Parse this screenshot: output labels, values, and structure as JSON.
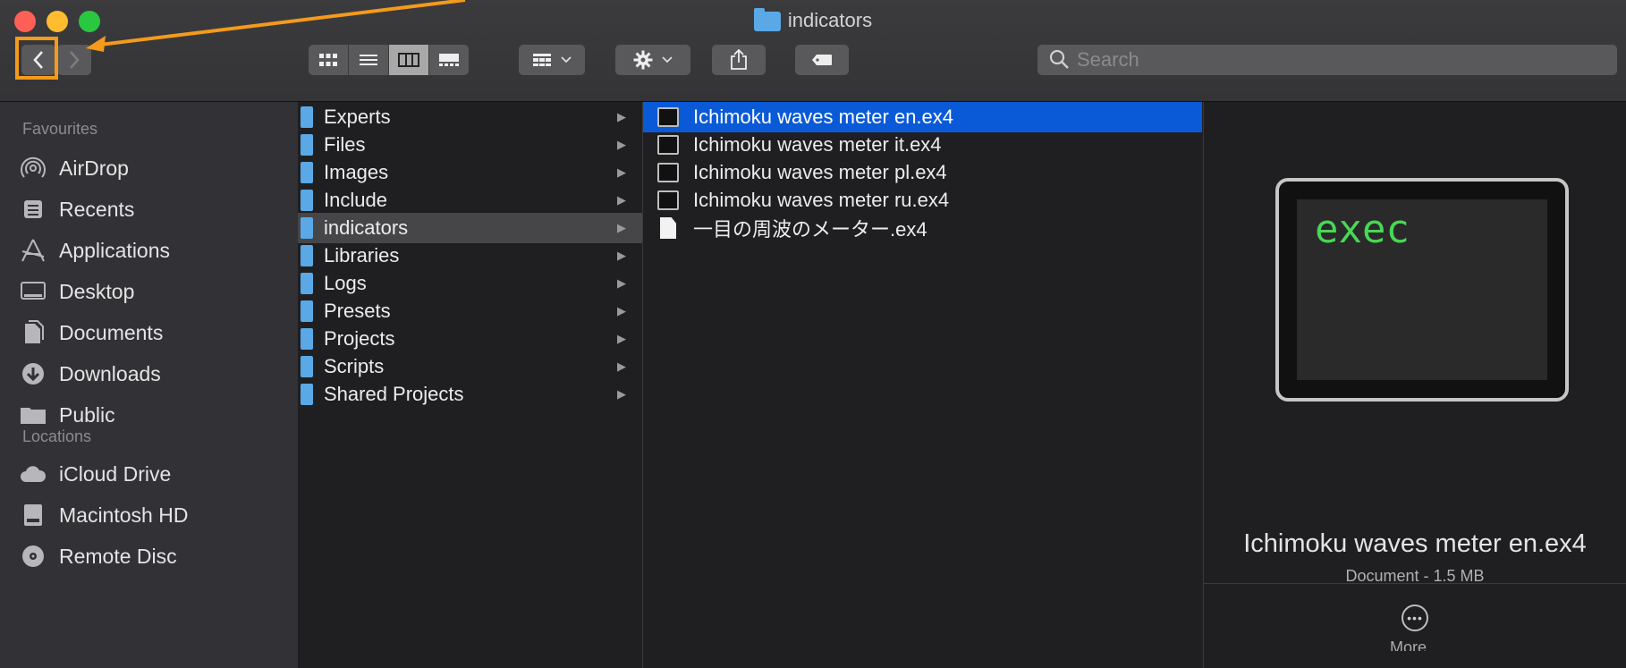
{
  "window": {
    "title": "indicators"
  },
  "toolbar": {
    "back_icon": "chevron-left-icon",
    "forward_icon": "chevron-right-icon",
    "search_placeholder": "Search",
    "highlight_color": "#f49a1c"
  },
  "sidebar": {
    "favourites_heading": "Favourites",
    "favourites": [
      {
        "label": "AirDrop",
        "icon": "airdrop-icon"
      },
      {
        "label": "Recents",
        "icon": "recents-icon"
      },
      {
        "label": "Applications",
        "icon": "applications-icon"
      },
      {
        "label": "Desktop",
        "icon": "desktop-icon"
      },
      {
        "label": "Documents",
        "icon": "documents-icon"
      },
      {
        "label": "Downloads",
        "icon": "downloads-icon"
      },
      {
        "label": "Public",
        "icon": "folder-icon"
      }
    ],
    "locations_heading": "Locations",
    "locations": [
      {
        "label": "iCloud Drive",
        "icon": "cloud-icon"
      },
      {
        "label": "Macintosh HD",
        "icon": "disk-icon"
      },
      {
        "label": "Remote Disc",
        "icon": "disc-icon"
      }
    ]
  },
  "column1": {
    "items": [
      "Experts",
      "Files",
      "Images",
      "Include",
      "indicators",
      "Libraries",
      "Logs",
      "Presets",
      "Projects",
      "Scripts",
      "Shared Projects"
    ],
    "selected": "indicators"
  },
  "column2": {
    "items": [
      "Ichimoku waves meter en.ex4",
      "Ichimoku waves meter it.ex4",
      "Ichimoku waves meter pl.ex4",
      "Ichimoku waves meter ru.ex4",
      "一目の周波のメーター.ex4"
    ],
    "selected": "Ichimoku waves meter en.ex4"
  },
  "preview": {
    "thumb_text": "exec",
    "name": "Ichimoku waves meter en.ex4",
    "kind": "Document - 1.5 MB",
    "more_label": "More..."
  },
  "colors": {
    "selection": "#0a5ad8",
    "folder": "#5aa8e6",
    "exec_green": "#47d855"
  }
}
